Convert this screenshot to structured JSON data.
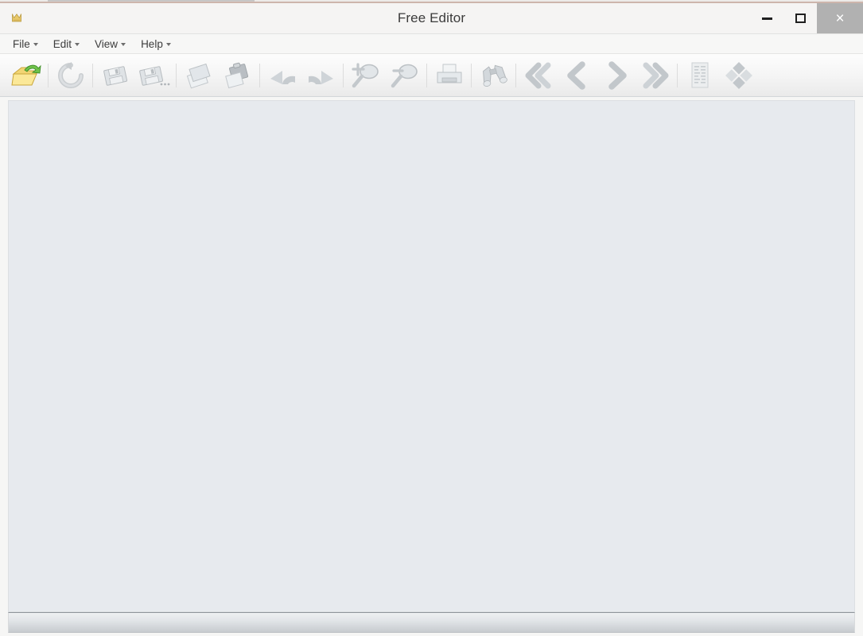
{
  "window": {
    "title": "Free Editor",
    "app_icon": "crown-icon",
    "controls": {
      "minimize_label": "–",
      "maximize_label": "□",
      "close_label": "×",
      "close_bg": "#b1b1b1"
    }
  },
  "menu": {
    "items": [
      {
        "label": "File",
        "caret": true
      },
      {
        "label": "Edit",
        "caret": true
      },
      {
        "label": "View",
        "caret": true
      },
      {
        "label": "Help",
        "caret": true
      }
    ]
  },
  "toolbar": {
    "groups": [
      {
        "buttons": [
          {
            "name": "open-folder-icon",
            "label": "Open",
            "enabled": true
          }
        ]
      },
      {
        "buttons": [
          {
            "name": "reload-icon",
            "label": "Reload",
            "enabled": false
          }
        ]
      },
      {
        "buttons": [
          {
            "name": "save-icon",
            "label": "Save",
            "enabled": false
          },
          {
            "name": "save-as-icon",
            "label": "Save As...",
            "enabled": false
          }
        ]
      },
      {
        "buttons": [
          {
            "name": "copy-icon",
            "label": "Copy",
            "enabled": false
          },
          {
            "name": "paste-icon",
            "label": "Paste",
            "enabled": false
          }
        ]
      },
      {
        "buttons": [
          {
            "name": "undo-icon",
            "label": "Undo",
            "enabled": false
          },
          {
            "name": "redo-icon",
            "label": "Redo",
            "enabled": false
          }
        ]
      },
      {
        "buttons": [
          {
            "name": "zoom-in-icon",
            "label": "Zoom In",
            "enabled": false
          },
          {
            "name": "zoom-out-icon",
            "label": "Zoom Out",
            "enabled": false
          }
        ]
      },
      {
        "buttons": [
          {
            "name": "print-icon",
            "label": "Print",
            "enabled": false
          }
        ]
      },
      {
        "buttons": [
          {
            "name": "binoculars-find-icon",
            "label": "Find",
            "enabled": false
          }
        ]
      },
      {
        "buttons": [
          {
            "name": "first-page-icon",
            "label": "First Page",
            "enabled": false
          },
          {
            "name": "previous-page-icon",
            "label": "Previous Page",
            "enabled": false
          },
          {
            "name": "next-page-icon",
            "label": "Next Page",
            "enabled": false
          },
          {
            "name": "last-page-icon",
            "label": "Last Page",
            "enabled": false
          }
        ]
      },
      {
        "buttons": [
          {
            "name": "text-page-icon",
            "label": "Text View",
            "enabled": false
          },
          {
            "name": "rotate-diamond-icon",
            "label": "Rotate",
            "enabled": false
          }
        ]
      }
    ]
  },
  "canvas": {
    "content": "",
    "background": "#e7eaee"
  },
  "status_bar": {
    "text": ""
  }
}
